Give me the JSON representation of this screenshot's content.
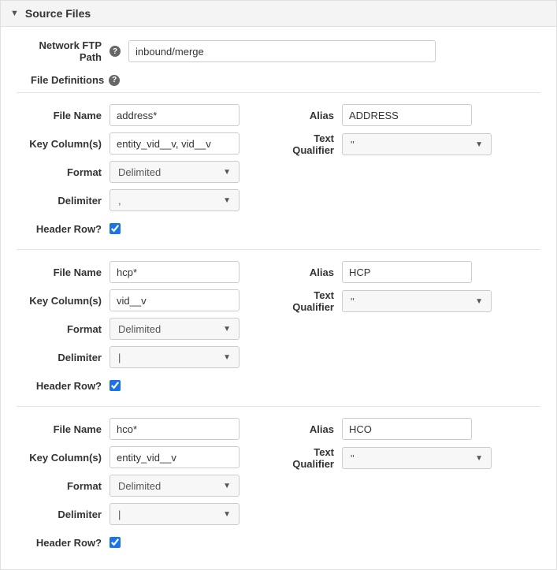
{
  "section": {
    "title": "Source Files"
  },
  "network_ftp": {
    "label": "Network FTP Path",
    "value": "inbound/merge"
  },
  "file_definitions_header": "File Definitions",
  "labels": {
    "file_name": "File Name",
    "key_columns": "Key Column(s)",
    "format": "Format",
    "delimiter": "Delimiter",
    "header_row": "Header Row?",
    "alias": "Alias",
    "text_qualifier": "Text Qualifier"
  },
  "defs": [
    {
      "file_name": "address*",
      "key_columns": "entity_vid__v, vid__v",
      "format": "Delimited",
      "delimiter": ",",
      "header_row": true,
      "alias": "ADDRESS",
      "text_qualifier": "\""
    },
    {
      "file_name": "hcp*",
      "key_columns": "vid__v",
      "format": "Delimited",
      "delimiter": "|",
      "header_row": true,
      "alias": "HCP",
      "text_qualifier": "\""
    },
    {
      "file_name": "hco*",
      "key_columns": "entity_vid__v",
      "format": "Delimited",
      "delimiter": "|",
      "header_row": true,
      "alias": "HCO",
      "text_qualifier": "\""
    }
  ]
}
